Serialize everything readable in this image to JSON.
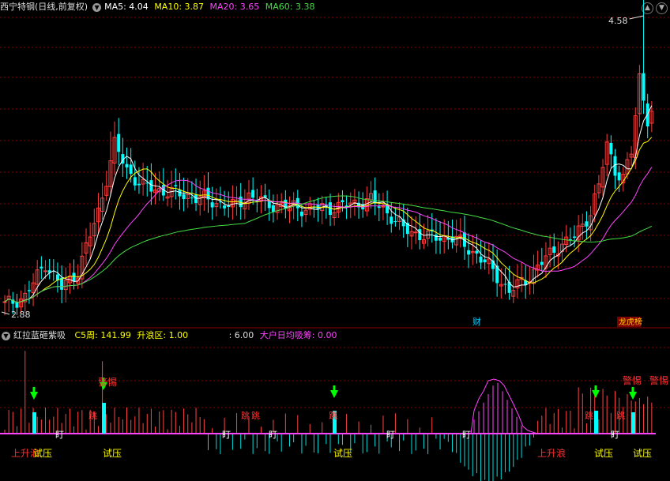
{
  "header": {
    "stock_title": "西宁特钢(日线,前复权)",
    "ma": [
      {
        "label": "MA5: 4.04",
        "color": "#ffffff"
      },
      {
        "label": "MA10: 3.87",
        "color": "#ffff00"
      },
      {
        "label": "MA20: 3.65",
        "color": "#ff44ff"
      },
      {
        "label": "MA60: 3.38",
        "color": "#44dd44"
      }
    ],
    "window_buttons": [
      {
        "name": "nav-up-icon",
        "glyph": "▲"
      },
      {
        "name": "nav-down-icon",
        "glyph": "▼"
      }
    ]
  },
  "price_panel": {
    "high_label": "4.58",
    "low_label": "2.88",
    "event_marker_fin": "财",
    "event_marker_list": "龙虎榜",
    "price_range": [
      2.78,
      4.62
    ],
    "colors": {
      "up": "#ff3c3c",
      "down": "#00ffff",
      "ma5": "#ffffff",
      "ma10": "#ffff00",
      "ma20": "#ff44ff",
      "ma60": "#44dd44",
      "grid": "#8b0000"
    }
  },
  "indicator_panel": {
    "name": "红拉蓝砸紫吸",
    "c5_label": "C5周: 141.99",
    "wave_label": "升浪区: 1.00",
    "val_label": ": 6.00",
    "big_label": "大户日均吸筹: 0.00",
    "signals": {
      "warn": "警惕",
      "test": "试压",
      "rise": "上升浪",
      "watch": "盯",
      "jump": "跳"
    },
    "colors": {
      "test": "#ffff00",
      "warn": "#ff3030",
      "rise": "#ff3030",
      "watch": "#ffffff",
      "arrow": "#00ff00",
      "purple": "#ff44ff"
    }
  },
  "chart_data": {
    "type": "candlestick",
    "series_count": 160,
    "ma_periods": [
      5,
      10,
      20,
      60
    ],
    "price_high": 4.58,
    "price_low": 2.88,
    "last_close": 4.04
  }
}
